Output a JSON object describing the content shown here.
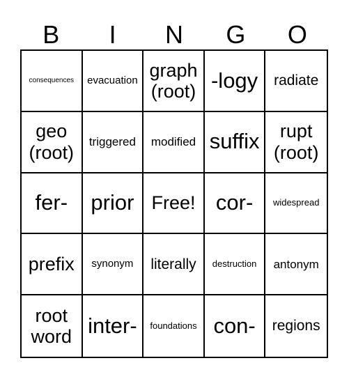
{
  "header": [
    "B",
    "I",
    "N",
    "G",
    "O"
  ],
  "cells": [
    "consequences",
    "evacuation",
    "graph (root)",
    "-logy",
    "radiate",
    "geo (root)",
    "triggered",
    "modified",
    "suffix",
    "rupt (root)",
    "fer-",
    "prior",
    "Free!",
    "cor-",
    "widespread",
    "prefix",
    "synonym",
    "literally",
    "destruction",
    "antonym",
    "root word",
    "inter-",
    "foundations",
    "con-",
    "regions"
  ]
}
